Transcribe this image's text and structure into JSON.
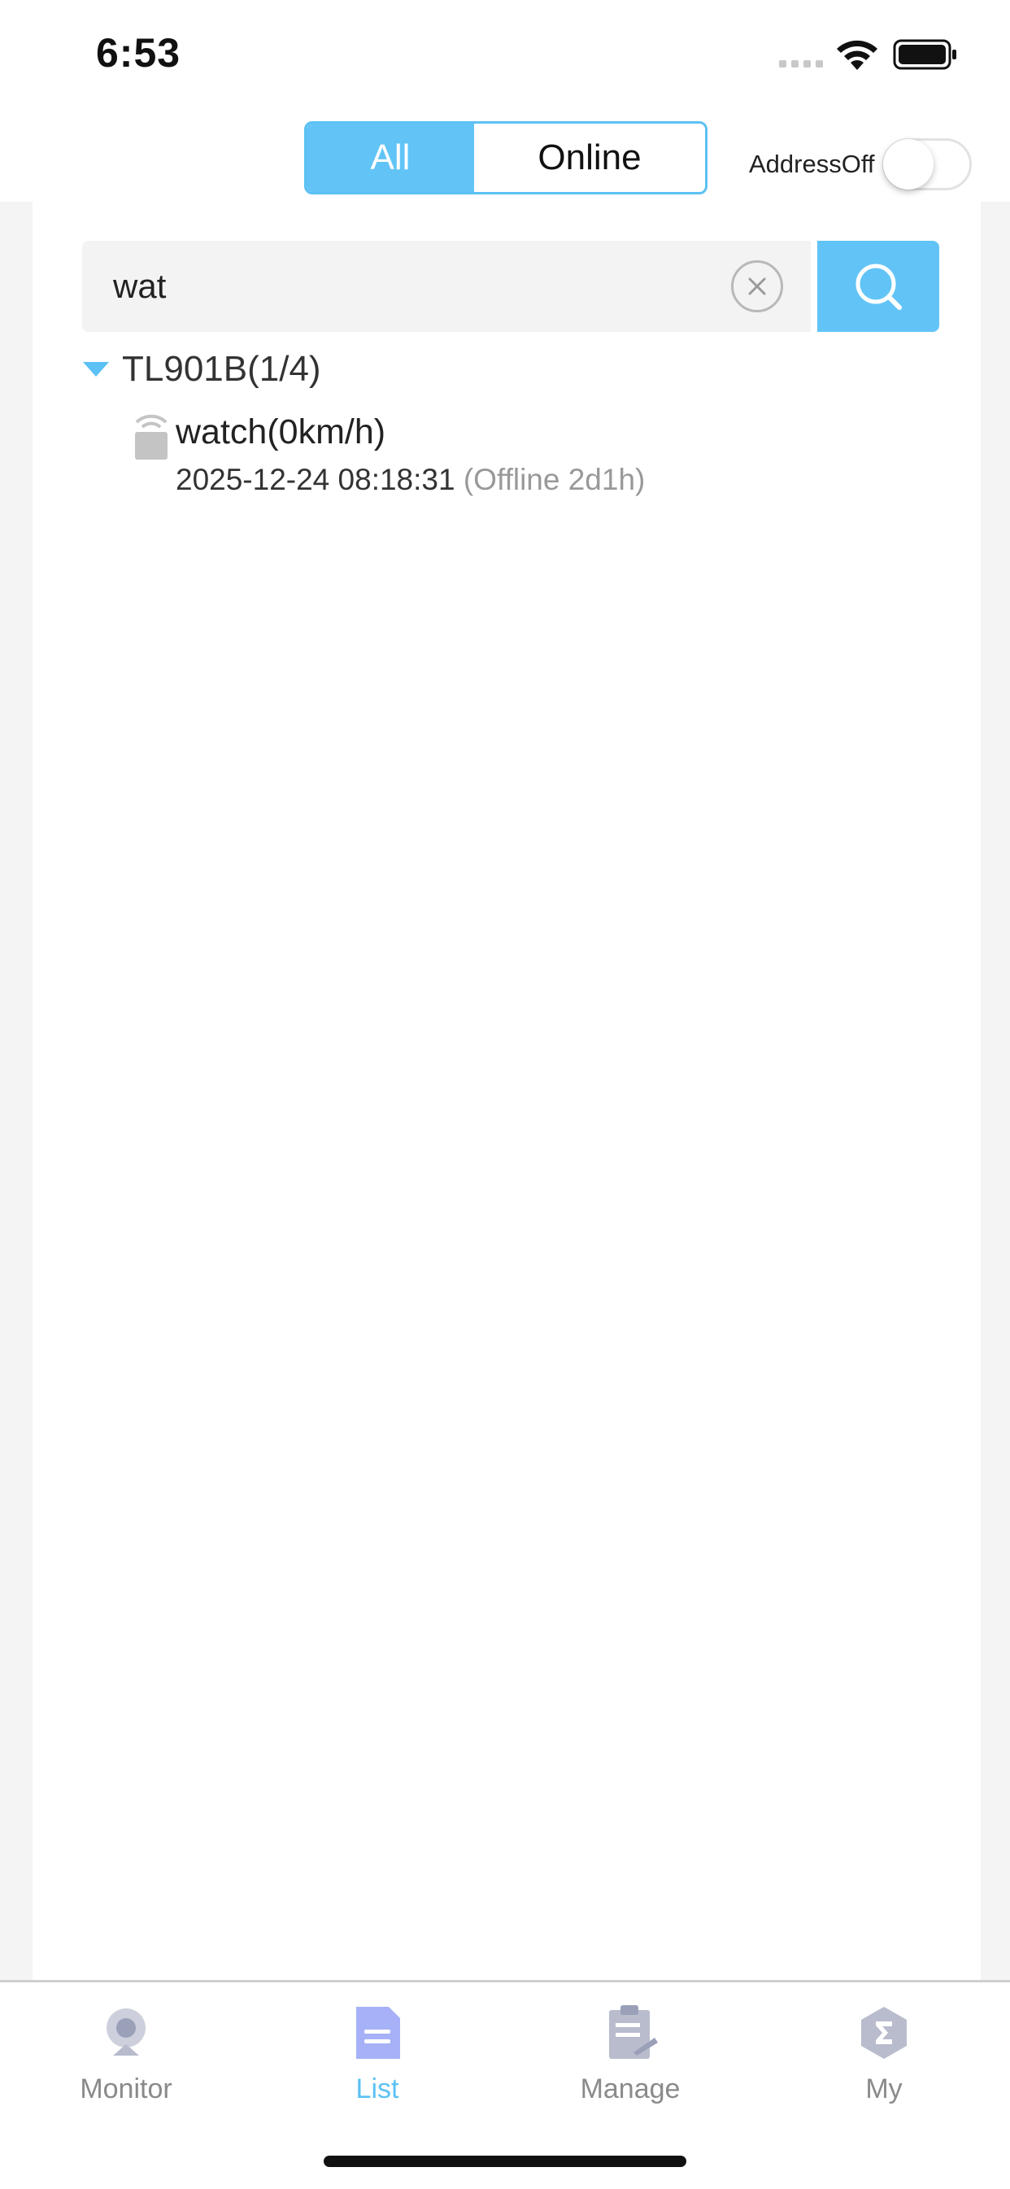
{
  "status_bar": {
    "time": "6:53"
  },
  "header": {
    "segments": {
      "all": "All",
      "online": "Online"
    },
    "address_toggle": {
      "label": "AddressOff",
      "on": false
    }
  },
  "search": {
    "value": "wat",
    "placeholder": ""
  },
  "tree": {
    "group": {
      "label": "TL901B(1/4)",
      "expanded": true
    },
    "devices": [
      {
        "name": "watch(0km/h)",
        "datetime": "2025-12-24 08:18:31",
        "status": "(Offline 2d1h)"
      }
    ]
  },
  "tabbar": {
    "items": [
      {
        "label": "Monitor",
        "icon": "monitor-camera-icon"
      },
      {
        "label": "List",
        "icon": "list-document-icon"
      },
      {
        "label": "Manage",
        "icon": "manage-clipboard-icon"
      },
      {
        "label": "My",
        "icon": "my-sigma-hexagon-icon"
      }
    ],
    "active": "List"
  },
  "colors": {
    "accent": "#62c4f6",
    "offline": "#999999",
    "inactive_tab": "#8a8a8a"
  }
}
